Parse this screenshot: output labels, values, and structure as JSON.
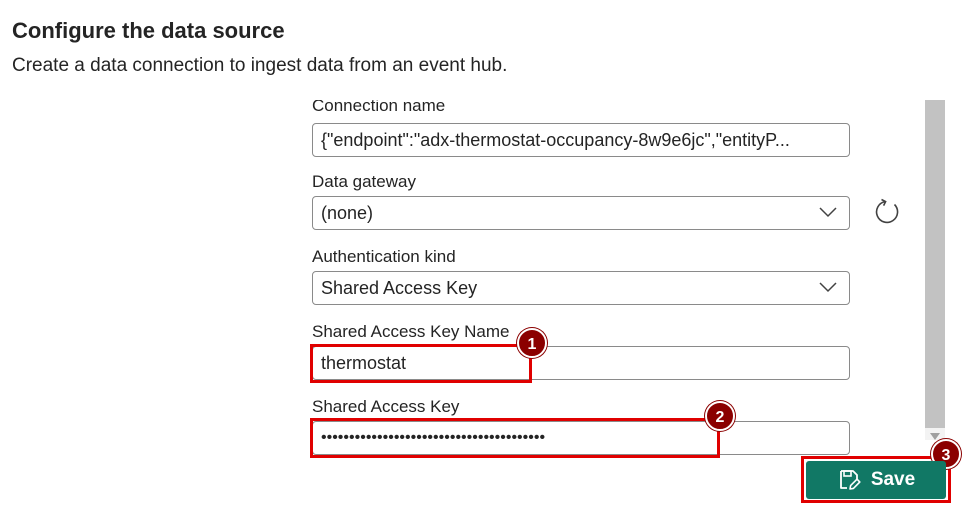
{
  "header": {
    "title": "Configure the data source",
    "subtitle": "Create a data connection to ingest data from an event hub."
  },
  "form": {
    "connection_name": {
      "label": "Connection name",
      "value": "{\"endpoint\":\"adx-thermostat-occupancy-8w9e6jc\",\"entityP..."
    },
    "data_gateway": {
      "label": "Data gateway",
      "value": "(none)"
    },
    "authentication_kind": {
      "label": "Authentication kind",
      "value": "Shared Access Key"
    },
    "shared_access_key_name": {
      "label": "Shared Access Key Name",
      "value": "thermostat"
    },
    "shared_access_key": {
      "label": "Shared Access Key",
      "value": "••••••••••••••••••••••••••••••••••••••••"
    }
  },
  "actions": {
    "save_label": "Save"
  },
  "callouts": [
    "1",
    "2",
    "3"
  ],
  "colors": {
    "highlight": "#e00000",
    "badge": "#8b0000",
    "save_button": "#117865"
  },
  "icons": {
    "refresh": "refresh-icon",
    "chevron": "chevron-down-icon",
    "save": "save-edit-icon"
  }
}
